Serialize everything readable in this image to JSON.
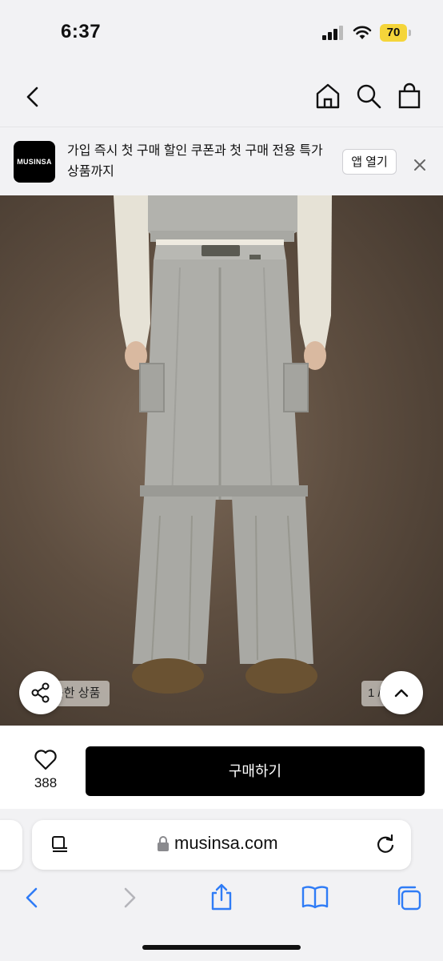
{
  "status_bar": {
    "time": "6:37",
    "battery": "70"
  },
  "nav": {
    "back": "back",
    "icons": [
      "home-icon",
      "search-icon",
      "bag-icon"
    ]
  },
  "banner": {
    "logo": "MUSINSA",
    "message": "가입 즉시 첫 구매 할인 쿠폰과 첫 구매 전용 특가 상품까지",
    "open_app": "앱 열기"
  },
  "product": {
    "similar_items": "슷한 상품",
    "page_indicator": "1 /"
  },
  "purchase": {
    "like_count": "388",
    "buy_label": "구매하기"
  },
  "browser": {
    "url": "musinsa.com"
  },
  "colors": {
    "page_bg": "#f2f2f4",
    "buy_button": "#000000",
    "battery": "#f5d53a",
    "accent_blue": "#2f7cf6"
  }
}
